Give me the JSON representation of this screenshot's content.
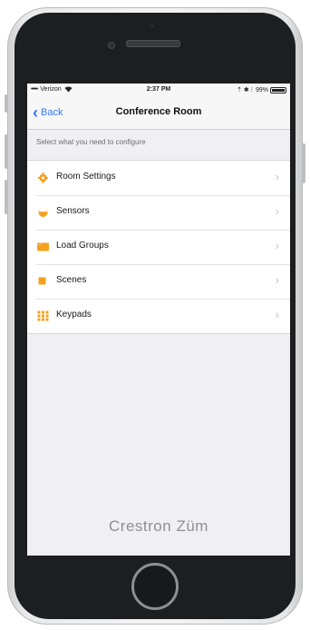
{
  "status_bar": {
    "signal": "•••••",
    "carrier": "Verizon",
    "wifi": "wifi-icon",
    "time": "2:37 PM",
    "indicators": "⇡ ✱ ⁝",
    "battery_percent": "99%",
    "battery_level": 0.99
  },
  "nav": {
    "back_label": "Back",
    "title": "Conference Room"
  },
  "section_header": "Select what you need to configure",
  "items": [
    {
      "label": "Room Settings",
      "icon": "gear-icon"
    },
    {
      "label": "Sensors",
      "icon": "sensor-icon"
    },
    {
      "label": "Load Groups",
      "icon": "load-groups-icon"
    },
    {
      "label": "Scenes",
      "icon": "scenes-icon"
    },
    {
      "label": "Keypads",
      "icon": "keypad-icon"
    }
  ],
  "brand": "Crestron Züm",
  "colors": {
    "accent": "#3478f6",
    "icon_orange": "#f5a01e",
    "background": "#efeff4"
  }
}
